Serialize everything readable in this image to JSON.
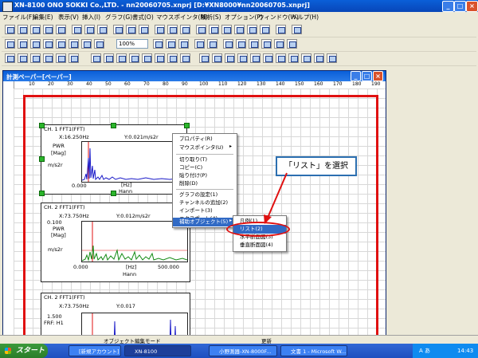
{
  "window": {
    "title": "XN-8100 ONO SOKKI Co.,LTD. - nn20060705.xnprj [D:¥XN8000¥nn20060705.xnprj]",
    "controls": [
      "_",
      "□",
      "×"
    ]
  },
  "menubar": [
    "ファイル(F)",
    "編集(E)",
    "表示(V)",
    "挿入(I)",
    "グラフ(G)",
    "書式(O)",
    "マウスポインタ(M)",
    "解析(S)",
    "オプション(P)",
    "ウィンドウ(W)",
    "ヘルプ(H)"
  ],
  "toolbar": {
    "zoom_value": "100%"
  },
  "inner_window": {
    "title": "計測ペーパー[ペーパー]",
    "ruler_ticks": [
      "10",
      "20",
      "30",
      "40",
      "50",
      "60",
      "70",
      "80",
      "90",
      "100",
      "110",
      "120",
      "130",
      "140",
      "150",
      "160",
      "170",
      "180",
      "190"
    ]
  },
  "charts": [
    {
      "header": "CH. 1  FFT1(FFT)",
      "cursor_x": "X:16.250Hz",
      "cursor_y": "Y:0.021m/s2r",
      "ylabel_top": "PWR",
      "ylabel_mid": "[Mag]",
      "yunit": "m/s2r",
      "ytop": "",
      "xmin": "0.000",
      "xmax": "50",
      "xunit": "[Hz]",
      "window": "Hann"
    },
    {
      "header": "CH. 2  FFT1(FFT)",
      "cursor_x": "X:73.750Hz",
      "cursor_y": "Y:0.012m/s2r",
      "ylabel_top": "PWR",
      "ylabel_mid": "[Mag]",
      "yunit": "m/s2r",
      "ytop": "0.100",
      "xmin": "0.000",
      "xmax": "500.000",
      "xunit": "[Hz]",
      "window": "Hann"
    },
    {
      "header": "CH. 2  FFT1(FFT)",
      "cursor_x": "X:73.750Hz",
      "cursor_y": "Y:0.017",
      "ytop": "1.500",
      "ylabel_top": "FRF: H1"
    }
  ],
  "context_menu": {
    "items": [
      "プロパティ(R)",
      "マウスポインタ(U)",
      "切り取り(T)",
      "コピー(C)",
      "貼り付け(P)",
      "削除(D)",
      "グラフの設定(1)",
      "チャンネルの追加(2)",
      "インポート(3)",
      "エクスポート(4)",
      "補助オブジェクト(5)"
    ],
    "highlighted": "補助オブジェクト(5)"
  },
  "submenu": {
    "items": [
      "凡例(1)",
      "リスト(2)",
      "水平断面図(3)",
      "垂直断面図(4)"
    ],
    "highlighted": "リスト(2)"
  },
  "callout": "「リスト」を選択",
  "status": {
    "mode": "オブジェクト編集モード",
    "state": "更新"
  },
  "taskbar": {
    "start": "スタート",
    "tasks": [
      "[新規アカウント] 送信...",
      "XN-8100",
      "小野測器-XN-8000F...",
      "文書 1 - Microsoft W..."
    ],
    "clock": "14:43",
    "tray_text": "A あ"
  },
  "colors": {
    "titlebar": "#0a5fd8",
    "red_frame": "#e01010",
    "menu_highlight": "#316ac5",
    "spectrum_blue": "#1a1ac8",
    "spectrum_green": "#138a13",
    "cursor_red": "#e01010",
    "callout_border": "#2c6fb0"
  }
}
